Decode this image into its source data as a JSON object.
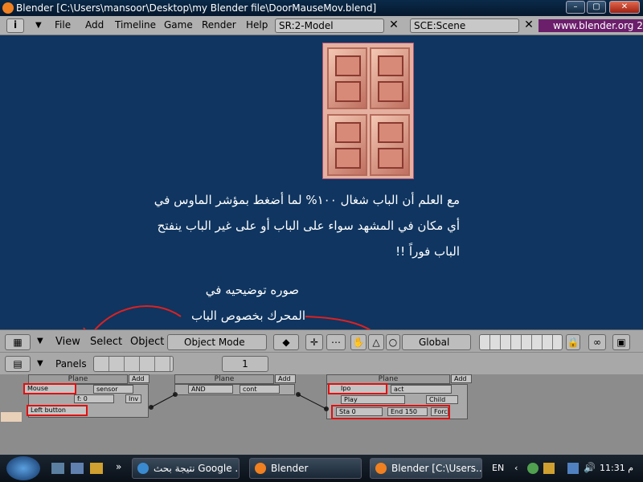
{
  "window": {
    "title": "Blender [C:\\Users\\mansoor\\Desktop\\my Blender file\\DoorMauseMov.blend]"
  },
  "menubar": {
    "items": [
      "File",
      "Add",
      "Timeline",
      "Game",
      "Render",
      "Help"
    ],
    "screen_field": "SR:2-Model",
    "scene_field": "SCE:Scene",
    "website": "www.blender.org 2"
  },
  "viewport": {
    "bg_color": "#0f3560",
    "arabic_lines": [
      "مع العلم أن الباب شغال ١٠٠% لما أضغط بمؤشر الماوس في",
      "أي مكان في المشهد سواء على الباب أو على غير الباب  ينفتح",
      "الباب فوراً  !!"
    ],
    "note_lines": [
      "صوره توضيحيه في",
      "المحرك بخصوص الباب"
    ]
  },
  "view3d_header": {
    "view": "View",
    "select": "Select",
    "object": "Object",
    "mode": "Object Mode",
    "orientation": "Global"
  },
  "logic_header": {
    "panels": "Panels",
    "frame": "1"
  },
  "logic": {
    "sensor": {
      "header": "Plane",
      "add": "Add",
      "type": "Mouse",
      "name": "sensor",
      "f": "f: 0",
      "inv": "Inv",
      "event": "Left button"
    },
    "controller": {
      "header": "Plane",
      "add": "Add",
      "type": "AND",
      "name": "cont"
    },
    "actuator": {
      "header": "Plane",
      "add": "Add",
      "type": "Ipo",
      "name": "act",
      "play": "Play",
      "child": "Child",
      "sta": "Sta 0",
      "end": "End 150",
      "force": "Force"
    }
  },
  "taskbar": {
    "items": [
      "نتيجة بحث Google ...",
      "Blender",
      "Blender [C:\\Users..."
    ],
    "lang": "EN",
    "clock": "11:31 م"
  }
}
